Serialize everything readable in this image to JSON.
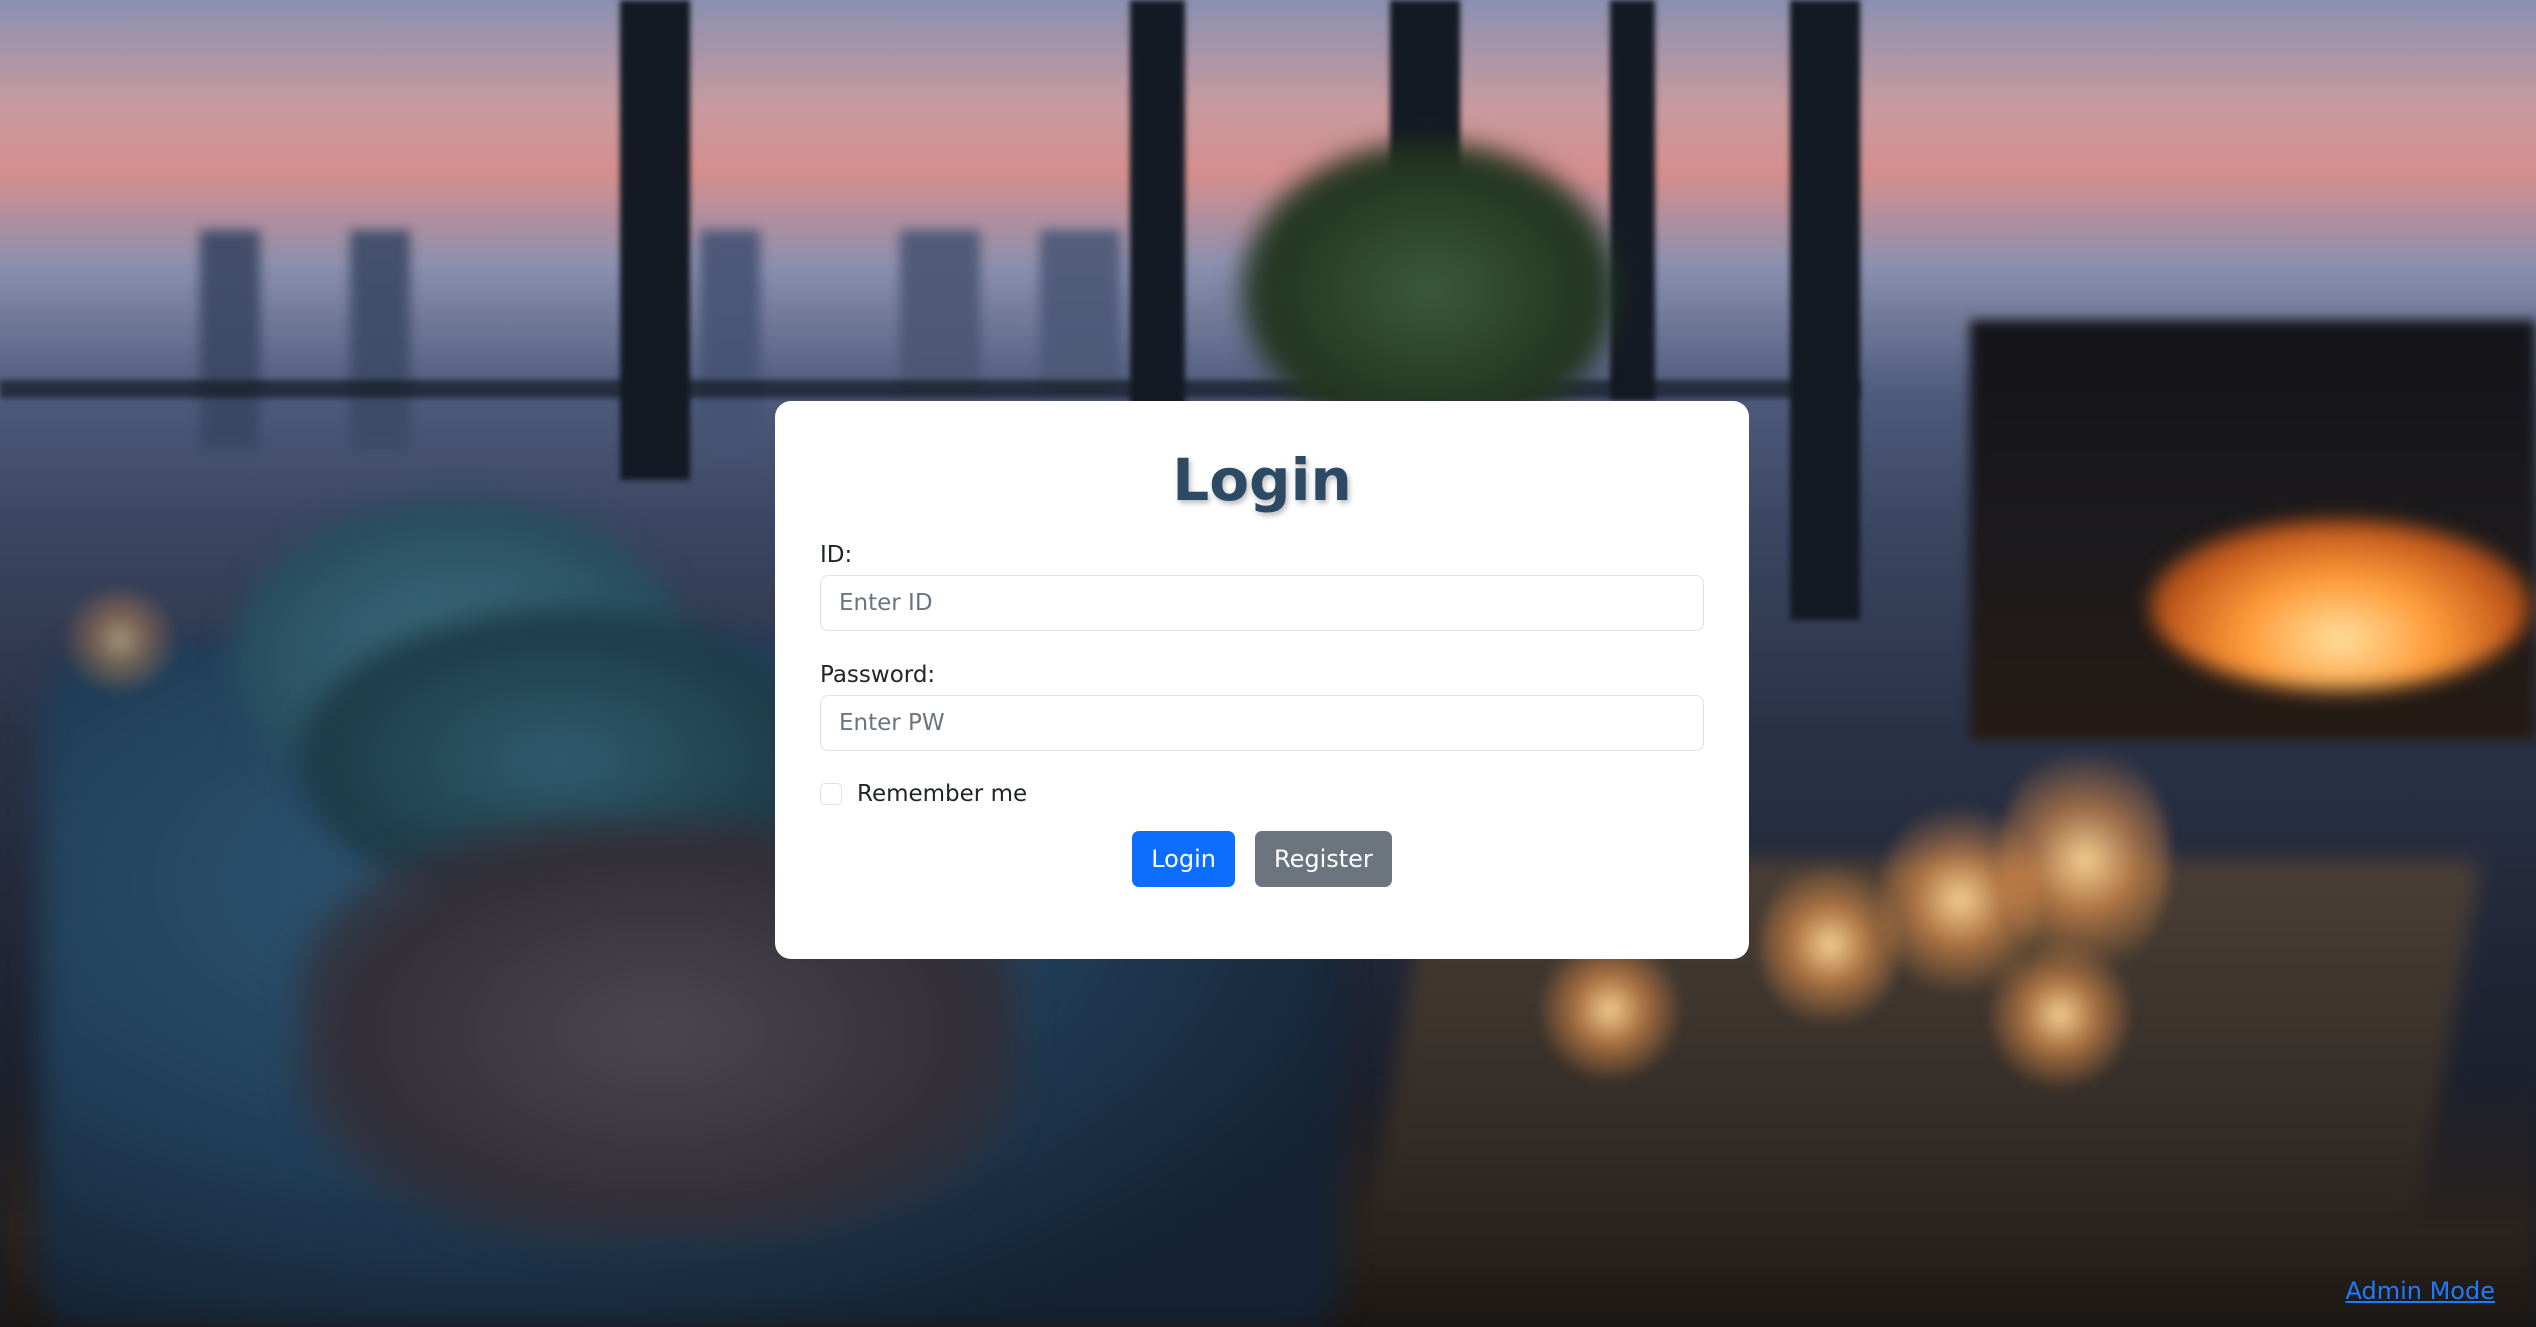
{
  "page": {
    "title": "Login"
  },
  "form": {
    "id_label": "ID:",
    "id_placeholder": "Enter ID",
    "id_value": "",
    "password_label": "Password:",
    "password_placeholder": "Enter PW",
    "password_value": "",
    "remember_label": "Remember me",
    "remember_checked": false
  },
  "actions": {
    "login_label": "Login",
    "register_label": "Register"
  },
  "footer": {
    "admin_link": "Admin Mode"
  },
  "colors": {
    "title": "#2c4a63",
    "primary_button": "#0d6efd",
    "secondary_button": "#6c757d",
    "link": "#1d7bff",
    "card_background": "#ffffff"
  },
  "icons": {
    "remember_checkbox": "empty-checkbox-icon"
  }
}
